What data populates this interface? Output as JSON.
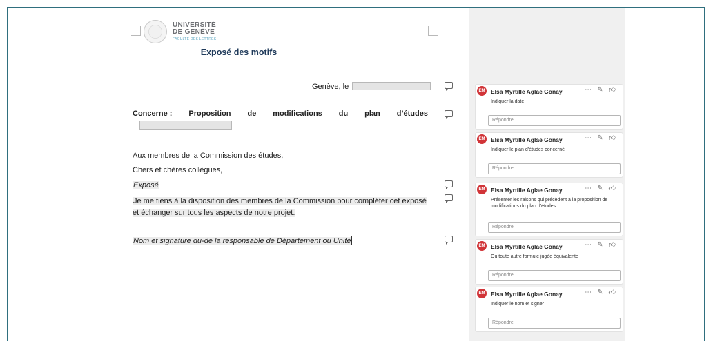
{
  "logo": {
    "line1": "UNIVERSITÉ",
    "line2": "DE GENÈVE",
    "line3": "FACULTÉ DES LETTRES"
  },
  "document": {
    "title": "Exposé des motifs",
    "date_prefix": "Genève, le",
    "concerne_words": [
      "Concerne :",
      "Proposition",
      "de",
      "modifications",
      "du",
      "plan",
      "d’études"
    ],
    "greeting1": "Aux membres de la Commission des études,",
    "greeting2": "Chers et chères collègues,",
    "expose": "Exposé",
    "paragraph_line1": "Je me tiens à la disposition des membres de la Commission pour compléter cet exposé",
    "paragraph_line2": "et échanger sur tous les aspects de notre projet.",
    "signature": "Nom et signature du-de la responsable de Département ou Unité"
  },
  "comments": [
    {
      "initials": "EM",
      "author": "Elsa Myrtille Aglae Gonay",
      "text": "Indiquer la date",
      "reply_placeholder": "Répondre"
    },
    {
      "initials": "EM",
      "author": "Elsa Myrtille Aglae Gonay",
      "text": "Indiquer le plan d’études concerné",
      "reply_placeholder": "Répondre"
    },
    {
      "initials": "EM",
      "author": "Elsa Myrtille Aglae Gonay",
      "text": "Présenter les raisons qui précèdent à la proposition de modifications du plan d’études",
      "reply_placeholder": "Répondre"
    },
    {
      "initials": "EM",
      "author": "Elsa Myrtille Aglae Gonay",
      "text": "Ou toute autre formule jugée équivalente",
      "reply_placeholder": "Répondre"
    },
    {
      "initials": "EM",
      "author": "Elsa Myrtille Aglae Gonay",
      "text": "Indiquer le nom et signer",
      "reply_placeholder": "Répondre"
    }
  ],
  "icons": {
    "more": "more-icon",
    "edit": "pencil-icon",
    "like": "thumbs-up-icon",
    "comment_marker": "comment-marker-icon"
  },
  "colors": {
    "frame": "#2f6f7e",
    "avatar": "#d13438",
    "title": "#1f3a5a",
    "pane": "#f0f0f0"
  }
}
